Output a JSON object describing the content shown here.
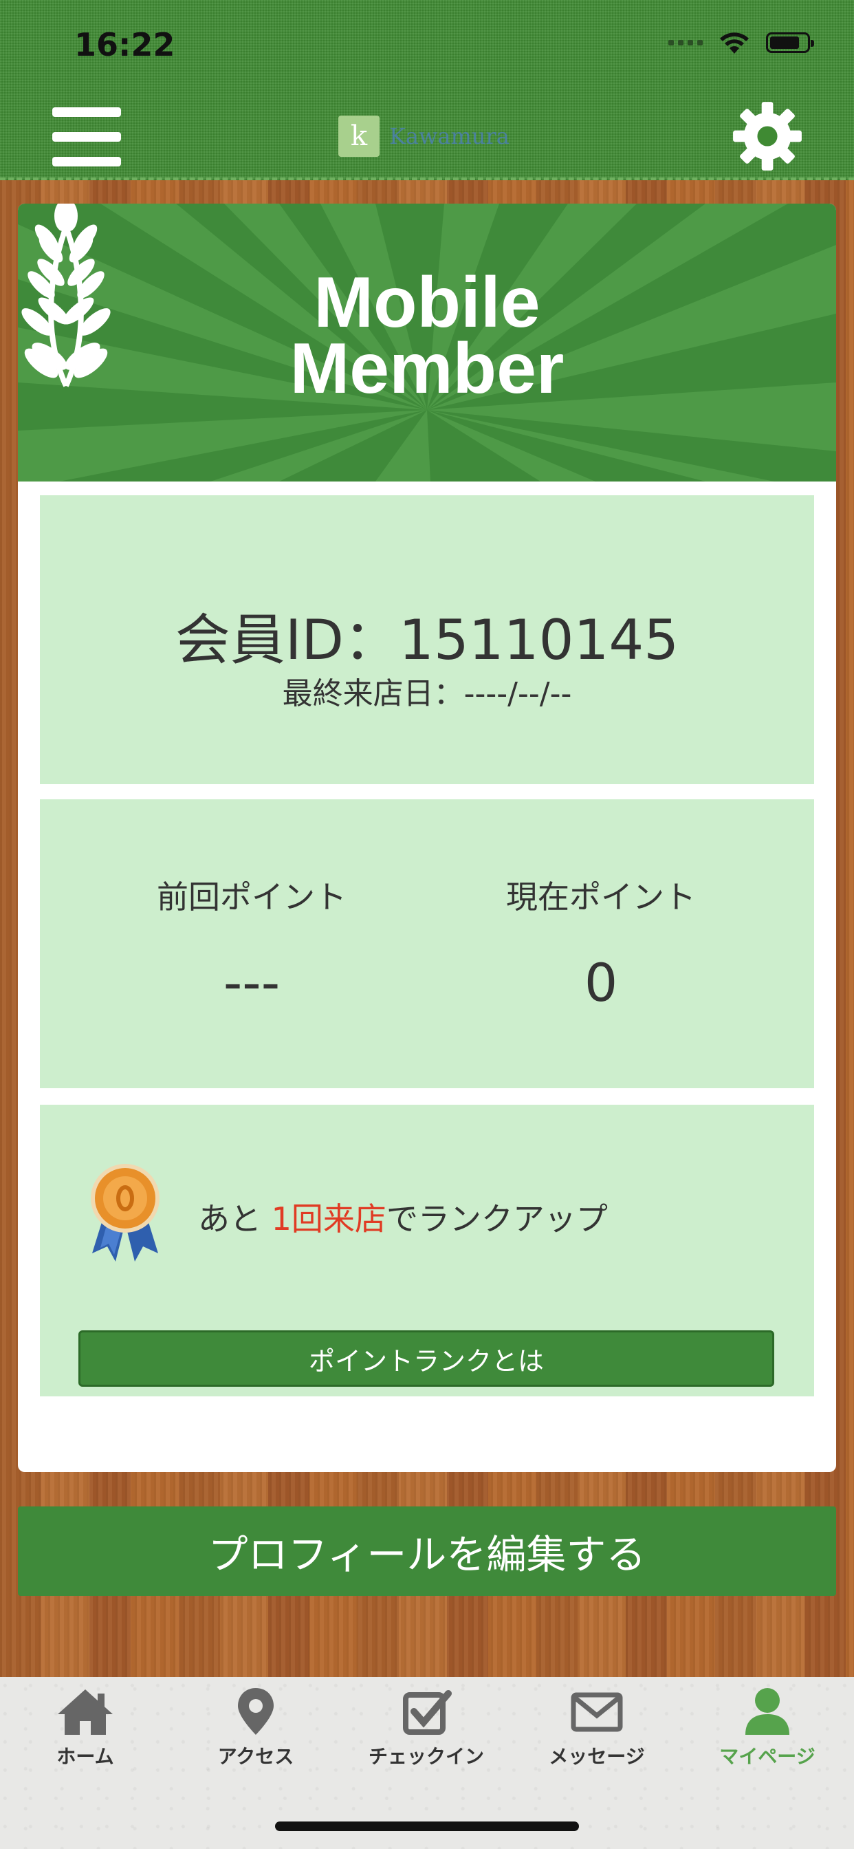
{
  "status_bar": {
    "time": "16:22"
  },
  "header": {
    "logo_letter": "k",
    "logo_text": "Kawamura"
  },
  "banner": {
    "title_line1": "Mobile",
    "title_line2": "Member"
  },
  "member": {
    "id_text": "会員ID：15110145",
    "last_visit": "最終来店日：----/--/--"
  },
  "points": {
    "previous_label": "前回ポイント",
    "previous_value": "---",
    "current_label": "現在ポイント",
    "current_value": "0"
  },
  "rank": {
    "text_before": "あと ",
    "text_highlight": "1回来店",
    "text_after": "でランクアップ",
    "button_label": "ポイントランクとは"
  },
  "edit_profile_label": "プロフィールを編集する",
  "tabs": [
    {
      "label": "ホーム",
      "icon": "home-icon"
    },
    {
      "label": "アクセス",
      "icon": "map-pin-icon"
    },
    {
      "label": "チェックイン",
      "icon": "checkin-icon"
    },
    {
      "label": "メッセージ",
      "icon": "envelope-icon"
    },
    {
      "label": "マイページ",
      "icon": "person-icon",
      "active": true
    }
  ],
  "colors": {
    "accent_green": "#3f8a3a",
    "panel_green": "#cdeecd",
    "highlight_red": "#e03b24",
    "active_tab": "#56a34c"
  }
}
